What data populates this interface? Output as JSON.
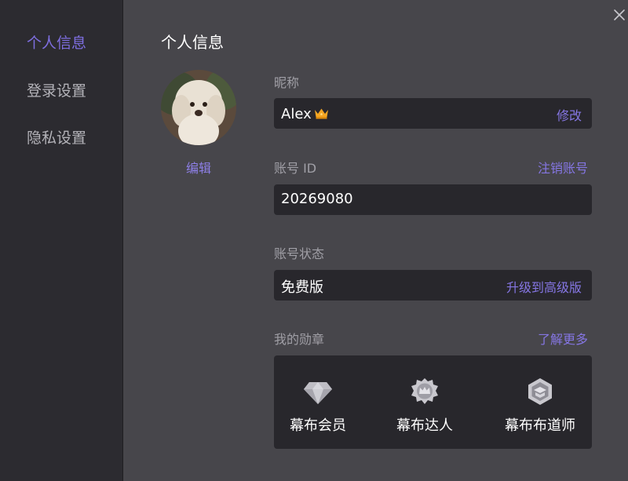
{
  "sidebar": {
    "items": [
      {
        "label": "个人信息",
        "active": true
      },
      {
        "label": "登录设置",
        "active": false
      },
      {
        "label": "隐私设置",
        "active": false
      }
    ]
  },
  "main": {
    "title": "个人信息",
    "avatar": {
      "edit_label": "编辑"
    },
    "nickname": {
      "label": "昵称",
      "value": "Alex",
      "action": "修改"
    },
    "account_id": {
      "label": "账号 ID",
      "link": "注销账号",
      "value": "20269080"
    },
    "account_status": {
      "label": "账号状态",
      "value": "免费版",
      "action": "升级到高级版"
    },
    "badges": {
      "label": "我的勋章",
      "link": "了解更多",
      "items": [
        {
          "label": "幕布会员",
          "icon": "diamond-icon"
        },
        {
          "label": "幕布达人",
          "icon": "crown-badge-icon"
        },
        {
          "label": "幕布布道师",
          "icon": "hexagon-badge-icon"
        }
      ]
    }
  },
  "colors": {
    "accent": "#7e6ee0",
    "sidebar_bg": "#2c2b30",
    "main_bg": "#47464b",
    "field_bg": "#28272c",
    "crown": "#f5a623"
  }
}
